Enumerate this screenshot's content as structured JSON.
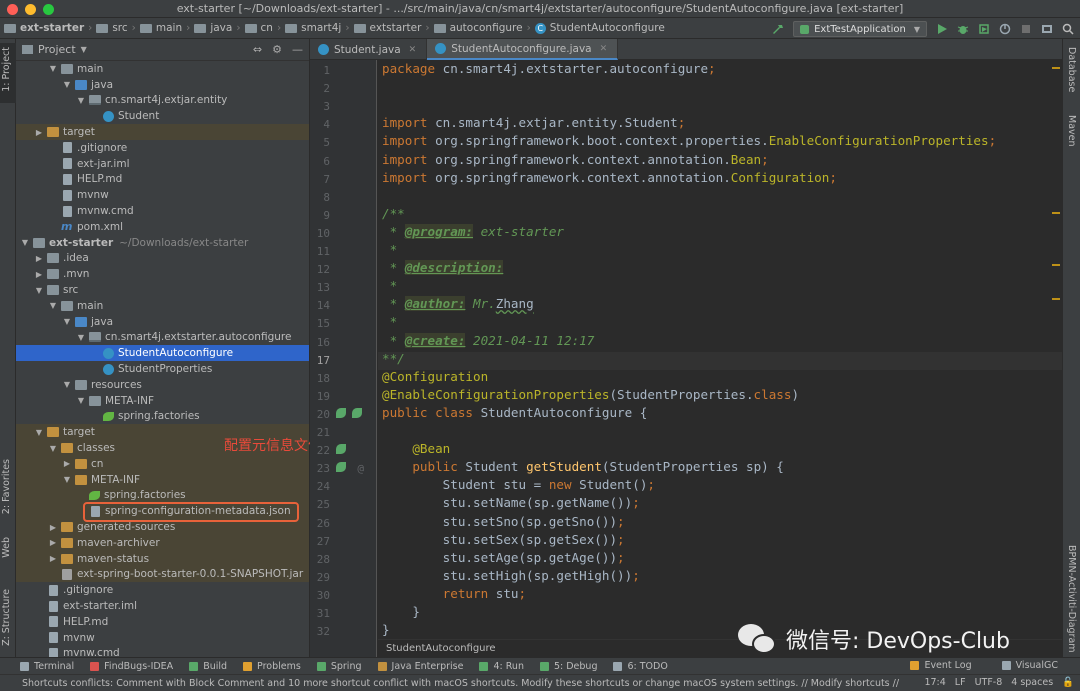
{
  "window": {
    "title": "ext-starter [~/Downloads/ext-starter] - .../src/main/java/cn/smart4j/extstarter/autoconfigure/StudentAutoconfigure.java [ext-starter]"
  },
  "breadcrumbs": [
    "ext-starter",
    "src",
    "main",
    "java",
    "cn",
    "smart4j",
    "extstarter",
    "autoconfigure",
    "StudentAutoconfigure"
  ],
  "run_config": "ExtTestApplication",
  "left_stripe": {
    "project": "1: Project",
    "favorites": "2: Favorites",
    "web": "Web",
    "structure": "Z: Structure"
  },
  "project_panel": {
    "title": "Project",
    "tree": [
      {
        "label": "main",
        "indent": 2,
        "icon": "folder",
        "arrow": "open"
      },
      {
        "label": "java",
        "indent": 3,
        "icon": "folder-blue",
        "arrow": "open"
      },
      {
        "label": "cn.smart4j.extjar.entity",
        "indent": 4,
        "icon": "package",
        "arrow": "open"
      },
      {
        "label": "Student",
        "indent": 5,
        "icon": "class",
        "arrow": ""
      },
      {
        "label": "target",
        "indent": 1,
        "icon": "folder-orange",
        "arrow": "closed",
        "excluded": true
      },
      {
        "label": ".gitignore",
        "indent": 2,
        "icon": "file",
        "arrow": ""
      },
      {
        "label": "ext-jar.iml",
        "indent": 2,
        "icon": "file",
        "arrow": ""
      },
      {
        "label": "HELP.md",
        "indent": 2,
        "icon": "file",
        "arrow": ""
      },
      {
        "label": "mvnw",
        "indent": 2,
        "icon": "file",
        "arrow": ""
      },
      {
        "label": "mvnw.cmd",
        "indent": 2,
        "icon": "file",
        "arrow": ""
      },
      {
        "label": "pom.xml",
        "indent": 2,
        "icon": "maven",
        "arrow": ""
      },
      {
        "label": "ext-starter",
        "dim": "~/Downloads/ext-starter",
        "indent": 0,
        "icon": "folder",
        "arrow": "open",
        "bold": true
      },
      {
        "label": ".idea",
        "indent": 1,
        "icon": "folder",
        "arrow": "closed"
      },
      {
        "label": ".mvn",
        "indent": 1,
        "icon": "folder",
        "arrow": "closed"
      },
      {
        "label": "src",
        "indent": 1,
        "icon": "folder",
        "arrow": "open"
      },
      {
        "label": "main",
        "indent": 2,
        "icon": "folder",
        "arrow": "open"
      },
      {
        "label": "java",
        "indent": 3,
        "icon": "folder-blue",
        "arrow": "open"
      },
      {
        "label": "cn.smart4j.extstarter.autoconfigure",
        "indent": 4,
        "icon": "package",
        "arrow": "open"
      },
      {
        "label": "StudentAutoconfigure",
        "indent": 5,
        "icon": "class",
        "arrow": "",
        "selected": true
      },
      {
        "label": "StudentProperties",
        "indent": 5,
        "icon": "class",
        "arrow": ""
      },
      {
        "label": "resources",
        "indent": 3,
        "icon": "folder",
        "arrow": "open"
      },
      {
        "label": "META-INF",
        "indent": 4,
        "icon": "folder",
        "arrow": "open"
      },
      {
        "label": "spring.factories",
        "indent": 5,
        "icon": "leaf",
        "arrow": ""
      },
      {
        "label": "target",
        "indent": 1,
        "icon": "folder-orange",
        "arrow": "open",
        "excluded": true
      },
      {
        "label": "classes",
        "indent": 2,
        "icon": "folder-orange",
        "arrow": "open",
        "excluded": true
      },
      {
        "label": "cn",
        "indent": 3,
        "icon": "folder-orange",
        "arrow": "closed",
        "excluded": true
      },
      {
        "label": "META-INF",
        "indent": 3,
        "icon": "folder-orange",
        "arrow": "open",
        "excluded": true
      },
      {
        "label": "spring.factories",
        "indent": 4,
        "icon": "leaf",
        "arrow": "",
        "excluded": true
      },
      {
        "label": "spring-configuration-metadata.json",
        "indent": 4,
        "icon": "file",
        "arrow": "",
        "excluded": true
      },
      {
        "label": "generated-sources",
        "indent": 2,
        "icon": "folder-orange",
        "arrow": "closed",
        "excluded": true
      },
      {
        "label": "maven-archiver",
        "indent": 2,
        "icon": "folder-orange",
        "arrow": "closed",
        "excluded": true
      },
      {
        "label": "maven-status",
        "indent": 2,
        "icon": "folder-orange",
        "arrow": "closed",
        "excluded": true
      },
      {
        "label": "ext-spring-boot-starter-0.0.1-SNAPSHOT.jar",
        "indent": 2,
        "icon": "jar",
        "arrow": "",
        "excluded": true
      },
      {
        "label": ".gitignore",
        "indent": 1,
        "icon": "file",
        "arrow": ""
      },
      {
        "label": "ext-starter.iml",
        "indent": 1,
        "icon": "file",
        "arrow": ""
      },
      {
        "label": "HELP.md",
        "indent": 1,
        "icon": "file",
        "arrow": ""
      },
      {
        "label": "mvnw",
        "indent": 1,
        "icon": "file",
        "arrow": ""
      },
      {
        "label": "mvnw.cmd",
        "indent": 1,
        "icon": "file",
        "arrow": ""
      }
    ]
  },
  "annotation": "配置元信息文件",
  "tabs": [
    {
      "label": "Student.java",
      "active": false
    },
    {
      "label": "StudentAutoconfigure.java",
      "active": true
    }
  ],
  "right_stripe": {
    "database": "Database",
    "maven": "Maven",
    "bpmn": "BPMN-Activiti-Diagram"
  },
  "editor": {
    "current_line": 17,
    "lines": [
      [
        [
          "kw",
          "package "
        ],
        [
          "p",
          "cn.smart4j.extstarter.autoconfigure"
        ],
        [
          "kw",
          ";"
        ]
      ],
      [],
      [],
      [
        [
          "kw",
          "import "
        ],
        [
          "p",
          "cn.smart4j.extjar.entity.Student"
        ],
        [
          "kw",
          ";"
        ]
      ],
      [
        [
          "kw",
          "import "
        ],
        [
          "p",
          "org.springframework.boot.context.properties."
        ],
        [
          "an",
          "EnableConfigurationProperties"
        ],
        [
          "kw",
          ";"
        ]
      ],
      [
        [
          "kw",
          "import "
        ],
        [
          "p",
          "org.springframework.context.annotation."
        ],
        [
          "an",
          "Bean"
        ],
        [
          "kw",
          ";"
        ]
      ],
      [
        [
          "kw",
          "import "
        ],
        [
          "p",
          "org.springframework.context.annotation."
        ],
        [
          "an",
          "Configuration"
        ],
        [
          "kw",
          ";"
        ]
      ],
      [],
      [
        [
          "doc",
          "/**"
        ]
      ],
      [
        [
          "doc",
          " * "
        ],
        [
          "dtag",
          "@program:"
        ],
        [
          "doc",
          " ext-starter"
        ]
      ],
      [
        [
          "doc",
          " *"
        ]
      ],
      [
        [
          "doc",
          " * "
        ],
        [
          "dtag",
          "@description:"
        ]
      ],
      [
        [
          "doc",
          " *"
        ]
      ],
      [
        [
          "doc",
          " * "
        ],
        [
          "dtag",
          "@author:"
        ],
        [
          "doc",
          " Mr."
        ],
        [
          "typo",
          "Zhang"
        ]
      ],
      [
        [
          "doc",
          " *"
        ]
      ],
      [
        [
          "doc",
          " * "
        ],
        [
          "dtag",
          "@create:"
        ],
        [
          "doc",
          " 2021-04-11 12:17"
        ]
      ],
      [
        [
          "doc",
          "**/"
        ]
      ],
      [
        [
          "an",
          "@Configuration"
        ]
      ],
      [
        [
          "an",
          "@EnableConfigurationProperties"
        ],
        [
          "p",
          "(StudentProperties."
        ],
        [
          "kw",
          "class"
        ],
        [
          "p",
          ")"
        ]
      ],
      [
        [
          "kw",
          "public class "
        ],
        [
          "p",
          "StudentAutoconfigure {"
        ]
      ],
      [],
      [
        [
          "p",
          "    "
        ],
        [
          "an",
          "@Bean"
        ]
      ],
      [
        [
          "p",
          "    "
        ],
        [
          "kw",
          "public "
        ],
        [
          "p",
          "Student "
        ],
        [
          "fn",
          "getStudent"
        ],
        [
          "p",
          "(StudentProperties sp) {"
        ]
      ],
      [
        [
          "p",
          "        Student stu = "
        ],
        [
          "kw",
          "new "
        ],
        [
          "p",
          "Student()"
        ],
        [
          "kw",
          ";"
        ]
      ],
      [
        [
          "p",
          "        stu.setName(sp.getName())"
        ],
        [
          "kw",
          ";"
        ]
      ],
      [
        [
          "p",
          "        stu.setSno(sp.getSno())"
        ],
        [
          "kw",
          ";"
        ]
      ],
      [
        [
          "p",
          "        stu.setSex(sp.getSex())"
        ],
        [
          "kw",
          ";"
        ]
      ],
      [
        [
          "p",
          "        stu.setAge(sp.getAge())"
        ],
        [
          "kw",
          ";"
        ]
      ],
      [
        [
          "p",
          "        stu.setHigh(sp.getHigh())"
        ],
        [
          "kw",
          ";"
        ]
      ],
      [
        [
          "p",
          "        "
        ],
        [
          "kw",
          "return "
        ],
        [
          "p",
          "stu"
        ],
        [
          "kw",
          ";"
        ]
      ],
      [
        [
          "p",
          "    }"
        ]
      ],
      [
        [
          "p",
          "}"
        ]
      ]
    ],
    "breadcrumb": "StudentAutoconfigure"
  },
  "watermark": "微信号: DevOps-Club",
  "tool_windows": {
    "left": [
      "Terminal",
      "FindBugs-IDEA",
      "Build",
      "Problems",
      "Spring",
      "Java Enterprise",
      "4: Run",
      "5: Debug",
      "6: TODO"
    ],
    "right": [
      "Event Log",
      "VisualGC"
    ]
  },
  "status": {
    "message": "Shortcuts conflicts: Comment with Block Comment and 10 more shortcut conflict with macOS shortcuts. Modify these shortcuts or change macOS system settings. // Modify shortcuts // Don't ... (21 minutes ago)",
    "position": "17:4",
    "line_sep": "LF",
    "encoding": "UTF-8",
    "indent": "4 spaces"
  },
  "colors": {
    "traffic_close": "#ff5f57",
    "traffic_min": "#febc2e",
    "traffic_max": "#28c840",
    "run": "#59a869",
    "annotation": "#e84a3a"
  }
}
